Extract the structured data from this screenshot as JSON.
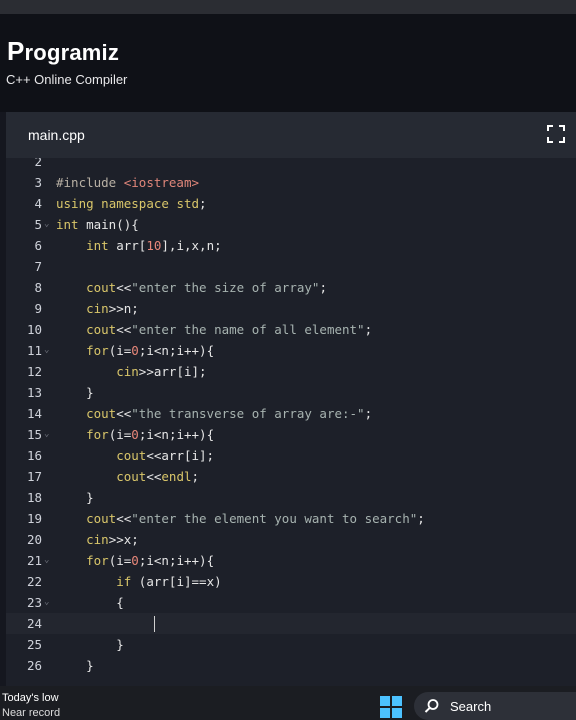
{
  "brand": {
    "logo_text": "Programiz",
    "subtitle": "C++ Online Compiler"
  },
  "editor": {
    "tab_label": "main.cpp",
    "lines": [
      {
        "no": "2",
        "fold": false,
        "text": ""
      },
      {
        "no": "3",
        "fold": false,
        "text": "#include <iostream>"
      },
      {
        "no": "4",
        "fold": false,
        "text": "using namespace std;"
      },
      {
        "no": "5",
        "fold": true,
        "text": "int main(){"
      },
      {
        "no": "6",
        "fold": false,
        "text": "    int arr[10],i,x,n;"
      },
      {
        "no": "7",
        "fold": false,
        "text": ""
      },
      {
        "no": "8",
        "fold": false,
        "text": "    cout<<\"enter the size of array\";"
      },
      {
        "no": "9",
        "fold": false,
        "text": "    cin>>n;"
      },
      {
        "no": "10",
        "fold": false,
        "text": "    cout<<\"enter the name of all element\";"
      },
      {
        "no": "11",
        "fold": true,
        "text": "    for(i=0;i<n;i++){"
      },
      {
        "no": "12",
        "fold": false,
        "text": "        cin>>arr[i];"
      },
      {
        "no": "13",
        "fold": false,
        "text": "    }"
      },
      {
        "no": "14",
        "fold": false,
        "text": "    cout<<\"the transverse of array are:-\";"
      },
      {
        "no": "15",
        "fold": true,
        "text": "    for(i=0;i<n;i++){"
      },
      {
        "no": "16",
        "fold": false,
        "text": "        cout<<arr[i];"
      },
      {
        "no": "17",
        "fold": false,
        "text": "        cout<<endl;"
      },
      {
        "no": "18",
        "fold": false,
        "text": "    }"
      },
      {
        "no": "19",
        "fold": false,
        "text": "    cout<<\"enter the element you want to search\";"
      },
      {
        "no": "20",
        "fold": false,
        "text": "    cin>>x;"
      },
      {
        "no": "21",
        "fold": true,
        "text": "    for(i=0;i<n;i++){"
      },
      {
        "no": "22",
        "fold": false,
        "text": "        if (arr[i]==x)"
      },
      {
        "no": "23",
        "fold": true,
        "text": "        {"
      },
      {
        "no": "24",
        "fold": false,
        "text": "",
        "active": true
      },
      {
        "no": "25",
        "fold": false,
        "text": "        }"
      },
      {
        "no": "26",
        "fold": false,
        "text": "    }"
      }
    ]
  },
  "taskbar": {
    "weather_line1": "Today's low",
    "weather_line2": "Near record",
    "search_label": "Search"
  },
  "colors": {
    "keyword": "#d9c66a",
    "string": "#a7b3b0",
    "number": "#e8877a",
    "editor_bg": "#1d2029"
  }
}
